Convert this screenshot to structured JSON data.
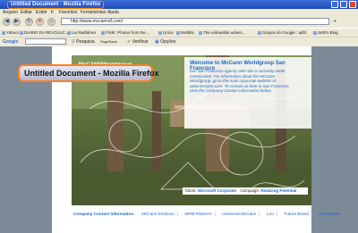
{
  "window": {
    "title": "Untitled Document - Mozilla Firefox"
  },
  "menu": [
    "Arquivo",
    "Editar",
    "Exibir",
    "Ir",
    "Favoritos",
    "Ferramentas",
    "Ajuda"
  ],
  "nav": {
    "url": "http://www.mccannsf.com/"
  },
  "bookmarks": [
    "Yahoo!",
    "DIARIO DA REVOLUC...",
    "Lui Radfahrer",
    "Flickr: Photos from Re...",
    "Unica",
    "Webfits",
    "The unfeasible adven...",
    "Grupos do Google : adf3",
    "Seth's Blog"
  ],
  "google_toolbar": {
    "label": "Google",
    "search": "Pesquisa",
    "pagerank": "PageRank",
    "verify": "Verificar",
    "options": "Opções"
  },
  "page": {
    "logo": "McCANNWorldgroup",
    "info_title": "Welcome to McCann Worldgroup San Francisco",
    "info_text": "Our San Francisco agency web site is currently under construction. For information about the McCann Worldgroup, go to the main corporate website at www.mccann.com. To contact us here in San Francisco, view the Company Contact Information below.",
    "client_label": "Client:",
    "client_value": "Microsoft Corporate",
    "campaign_label": "Campaign:",
    "campaign_value": "Realizing Potential",
    "footer_label": "Company Contact Information:",
    "footer_links": [
      "McCann Erickson",
      "MRM Partners",
      "Universal McCann",
      "LiCi",
      "Future Brand",
      "Momentum"
    ]
  },
  "zoom_overlay": "Untitled Document - Mozilla Firefox"
}
